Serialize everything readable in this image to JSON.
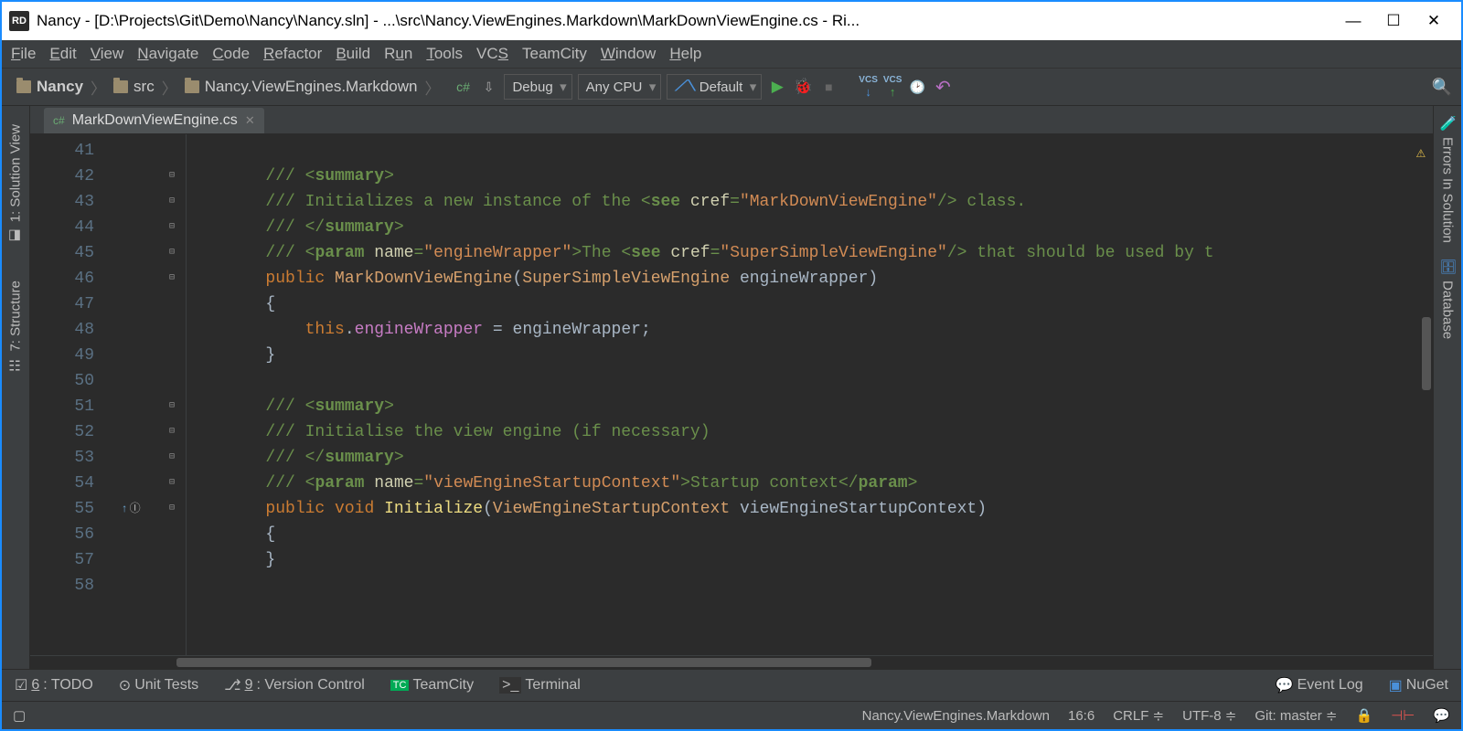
{
  "window": {
    "title": "Nancy - [D:\\Projects\\Git\\Demo\\Nancy\\Nancy.sln] - ...\\src\\Nancy.ViewEngines.Markdown\\MarkDownViewEngine.cs - Ri...",
    "logo": "RD"
  },
  "menu": [
    "File",
    "Edit",
    "View",
    "Navigate",
    "Code",
    "Refactor",
    "Build",
    "Run",
    "Tools",
    "VCS",
    "TeamCity",
    "Window",
    "Help"
  ],
  "breadcrumbs": [
    "Nancy",
    "src",
    "Nancy.ViewEngines.Markdown"
  ],
  "toolbar": {
    "config": "Debug",
    "platform": "Any CPU",
    "target": "Default"
  },
  "tab": {
    "name": "MarkDownViewEngine.cs"
  },
  "left_tabs": [
    "1: Solution View",
    "7: Structure"
  ],
  "right_tabs": [
    "Errors In Solution",
    "Database"
  ],
  "lines": {
    "start": 41,
    "end": 58
  },
  "bottom": {
    "todo": "6: TODO",
    "unit": "Unit Tests",
    "vcs": "9: Version Control",
    "tc": "TeamCity",
    "term": "Terminal",
    "event": "Event Log",
    "nuget": "NuGet"
  },
  "status": {
    "file": "Nancy.ViewEngines.Markdown",
    "pos": "16:6",
    "eol": "CRLF",
    "enc": "UTF-8",
    "git": "Git: master"
  }
}
